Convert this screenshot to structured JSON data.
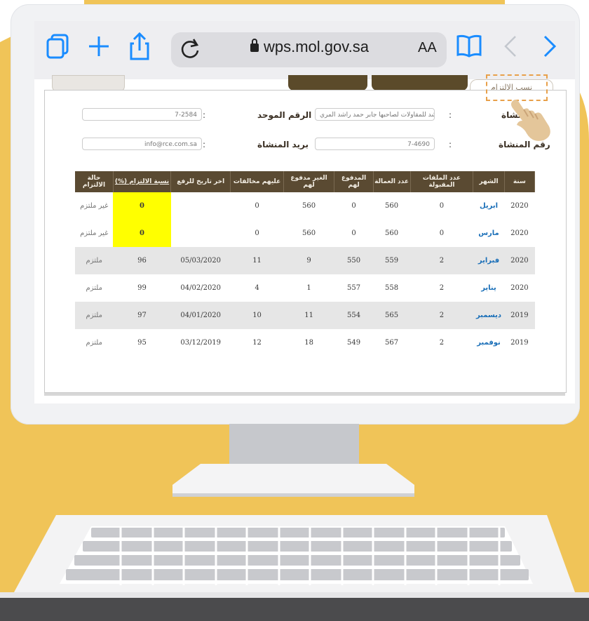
{
  "browser": {
    "url": "wps.mol.gov.sa",
    "text_size_label": "AA",
    "accent_color": "#1a8cff"
  },
  "page": {
    "active_tab": "نسب الالتزام",
    "fields": {
      "establishment_label": "المنشاة",
      "establishment_value": "مؤسسة راشد للمقاولات لصاحبها جابر حمد راشد المري",
      "unified_number_label": "الرقم الموحد",
      "unified_number_value": "7-2584",
      "establishment_number_label": "رقم المنشاة",
      "establishment_number_value": "7-4690",
      "email_label": "بريد المنشاة",
      "email_value": "info@rce.com.sa",
      "colon": ":"
    },
    "table": {
      "headers": [
        "سنة",
        "الشهر",
        "عدد الملفات المقبولة",
        "عدد العمالة",
        "المدفوع لهم",
        "الغير مدفوع لهم",
        "عليهم مخالفات",
        "اخر تاريخ للرفع",
        "نسبة الالتزام (%)",
        "حالة الالتزام"
      ],
      "rows": [
        {
          "year": "2020",
          "month": "ابريل",
          "files": "0",
          "workers": "560",
          "paid": "0",
          "unpaid": "560",
          "violations": "0",
          "last_upload": "",
          "ratio": "0",
          "status": "غير ملتزم"
        },
        {
          "year": "2020",
          "month": "مارس",
          "files": "0",
          "workers": "560",
          "paid": "0",
          "unpaid": "560",
          "violations": "0",
          "last_upload": "",
          "ratio": "0",
          "status": "غير ملتزم"
        },
        {
          "year": "2020",
          "month": "فبراير",
          "files": "2",
          "workers": "559",
          "paid": "550",
          "unpaid": "9",
          "violations": "11",
          "last_upload": "05/03/2020",
          "ratio": "96",
          "status": "ملتزم"
        },
        {
          "year": "2020",
          "month": "يناير",
          "files": "2",
          "workers": "558",
          "paid": "557",
          "unpaid": "1",
          "violations": "4",
          "last_upload": "04/02/2020",
          "ratio": "99",
          "status": "ملتزم"
        },
        {
          "year": "2019",
          "month": "ديسمبر",
          "files": "2",
          "workers": "565",
          "paid": "554",
          "unpaid": "11",
          "violations": "10",
          "last_upload": "04/01/2020",
          "ratio": "97",
          "status": "ملتزم"
        },
        {
          "year": "2019",
          "month": "نوفمبر",
          "files": "2",
          "workers": "567",
          "paid": "549",
          "unpaid": "18",
          "violations": "12",
          "last_upload": "03/12/2019",
          "ratio": "95",
          "status": "ملتزم"
        }
      ]
    }
  },
  "colors": {
    "background_yellow": "#f0c458",
    "header_brown": "#5a4a32",
    "highlight_yellow": "#ffff00",
    "highlight_border": "#e8a04a"
  }
}
